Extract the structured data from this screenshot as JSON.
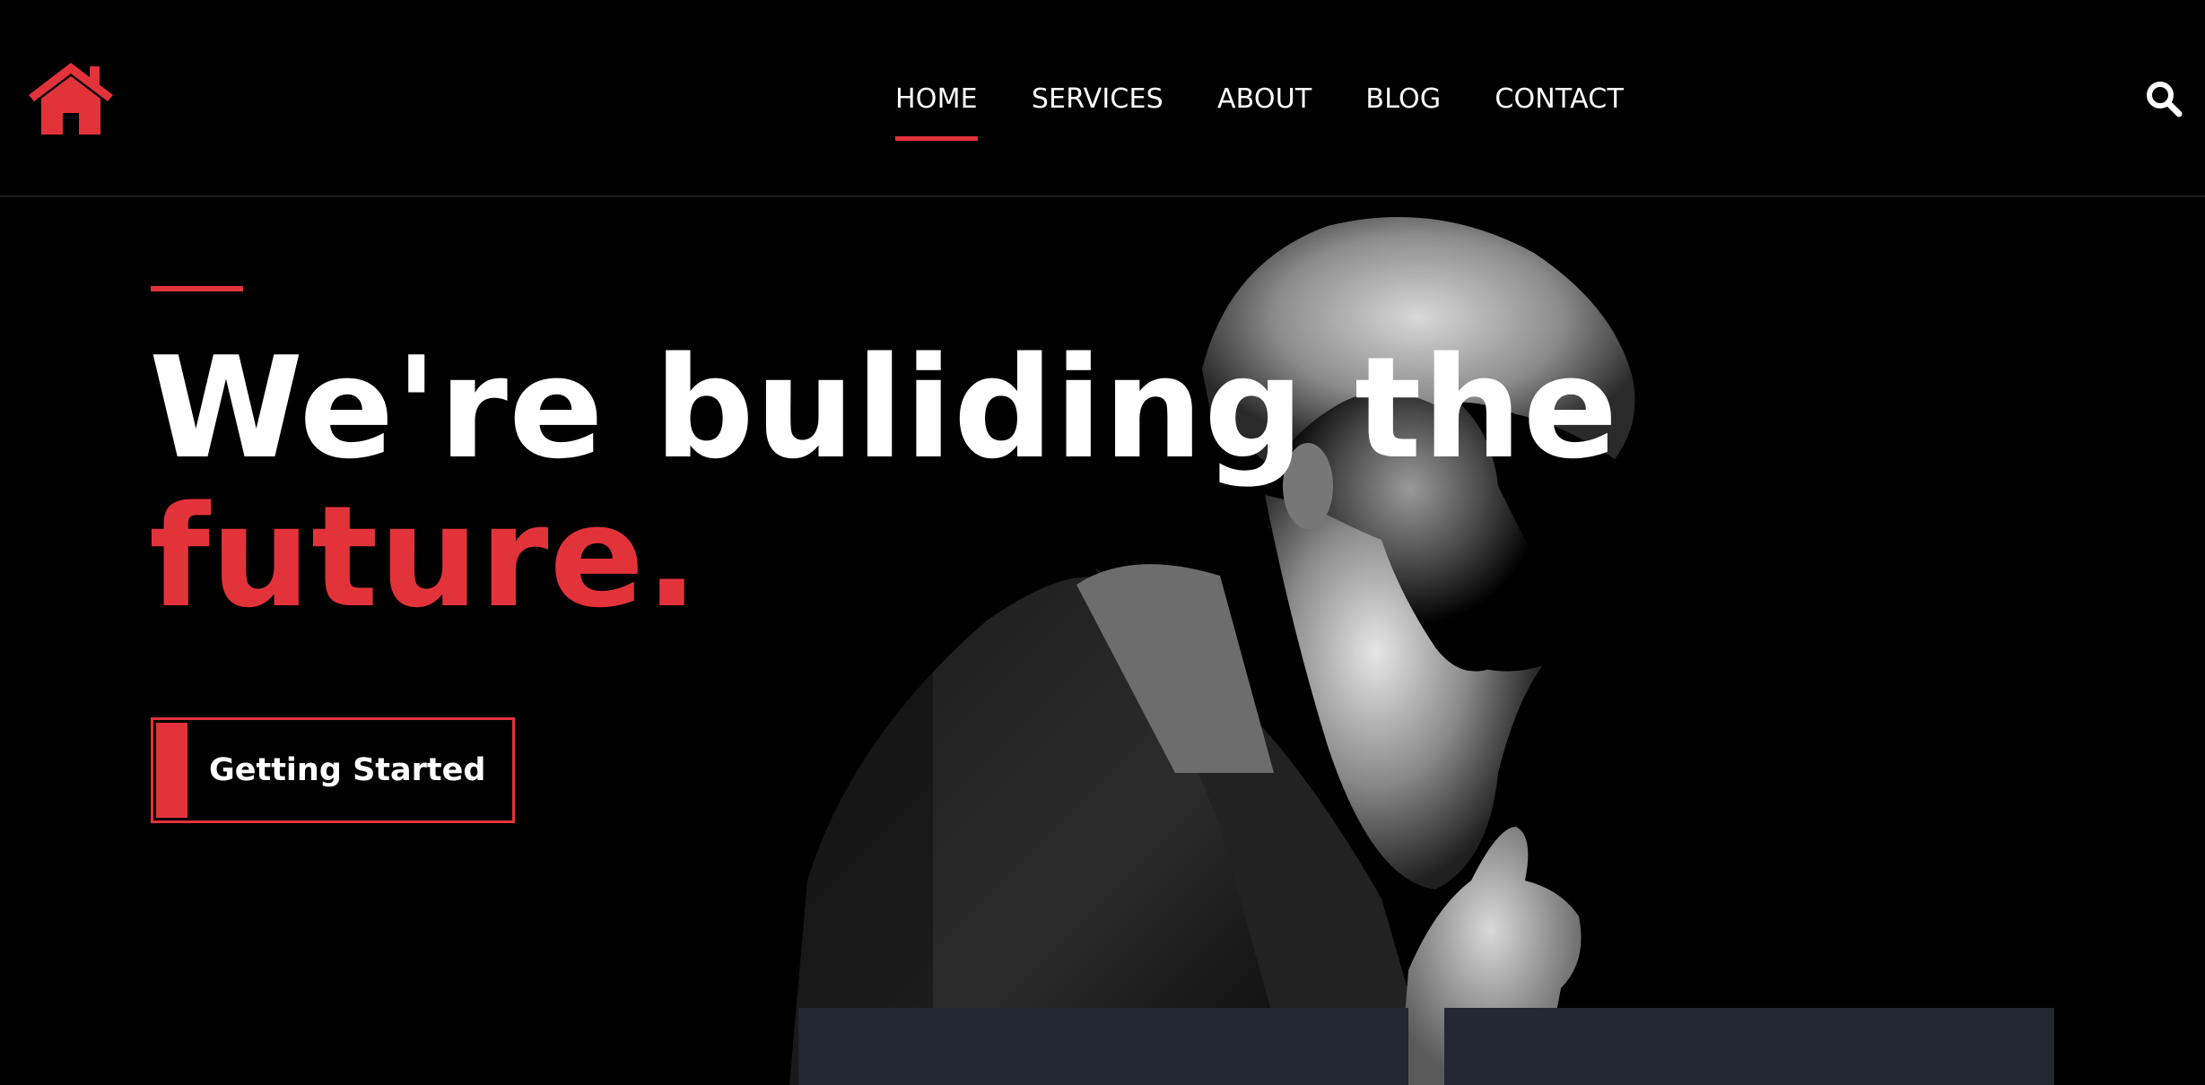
{
  "header": {
    "logo_icon": "house-icon",
    "nav": {
      "items": [
        {
          "label": "HOME",
          "active": true
        },
        {
          "label": "SERVICES",
          "active": false
        },
        {
          "label": "ABOUT",
          "active": false
        },
        {
          "label": "BLOG",
          "active": false
        },
        {
          "label": "CONTACT",
          "active": false
        }
      ]
    },
    "search_icon": "search-icon"
  },
  "hero": {
    "headline_line1": "We're buliding the",
    "headline_line2": "future.",
    "cta_label": "Getting Started"
  },
  "colors": {
    "background": "#000000",
    "accent": "#e3333a",
    "text": "#ffffff",
    "card": "#222731"
  }
}
